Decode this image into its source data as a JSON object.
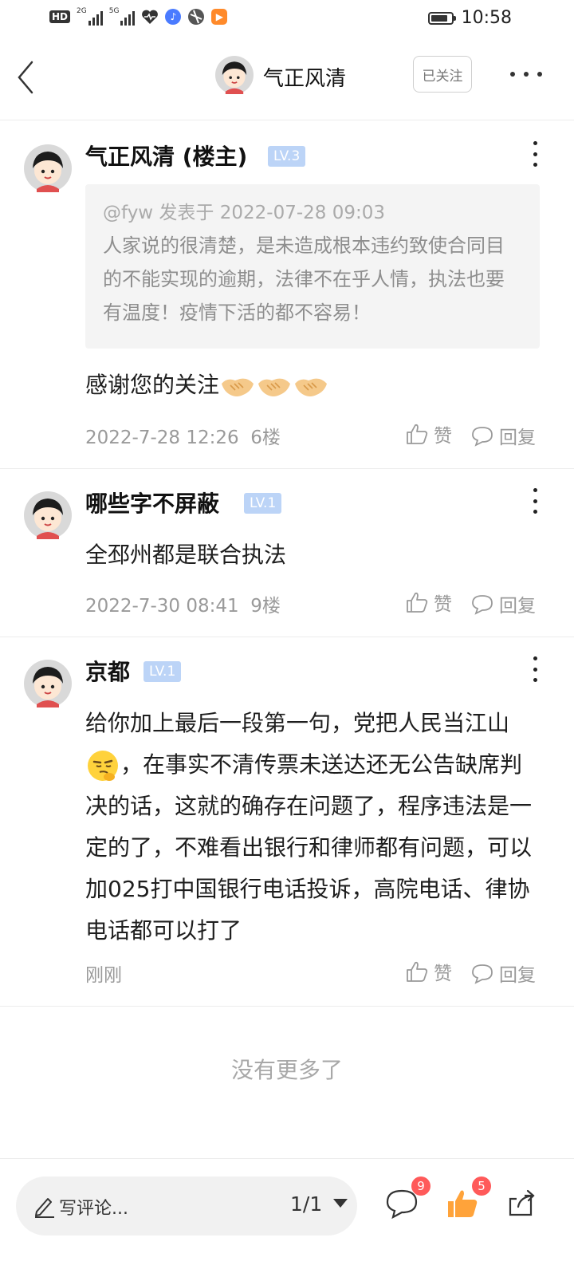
{
  "status_bar": {
    "hd_label": "HD",
    "net1": "2G",
    "net2": "5G",
    "time": "10:58",
    "battery_level": 0.85
  },
  "header": {
    "title": "气正风清",
    "follow_label": "已关注"
  },
  "comments": [
    {
      "name": "气正风清 (楼主)",
      "level": "LV.3",
      "quote": {
        "head": "@fyw 发表于 2022-07-28 09:03",
        "body": "人家说的很清楚，是未造成根本违约致使合同目的不能实现的逾期，法律不在乎人情，执法也要有温度！疫情下活的都不容易！"
      },
      "text": "感谢您的关注",
      "emoji": [
        "handshake",
        "handshake",
        "handshake"
      ],
      "date": "2022-7-28 12:26",
      "floor": "6楼",
      "like_label": "赞",
      "reply_label": "回复"
    },
    {
      "name": "哪些字不屏蔽",
      "level": "LV.1",
      "text": "全邳州都是联合执法",
      "date": "2022-7-30 08:41",
      "floor": "9楼",
      "like_label": "赞",
      "reply_label": "回复"
    },
    {
      "name": "京都",
      "level": "LV.1",
      "text_a": "给你加上最后一段第一句，党把人民当江山",
      "emoji": "thinking-face",
      "text_b": "，在事实不清传票未送达还无公告缺席判决的话，这就的确存在问题了，程序违法是一定的了，不难看出银行和律师都有问题，可以加025打中国银行电话投诉，高院电话、律协电话都可以打了",
      "date": "刚刚",
      "like_label": "赞",
      "reply_label": "回复"
    }
  ],
  "footer_text": "没有更多了",
  "bottom_bar": {
    "input_placeholder": "写评论...",
    "page_indicator": "1/1",
    "comment_count": "9",
    "like_count": "5"
  },
  "colors": {
    "level_badge": "#bcd4f7",
    "badge_red": "#ff5a5a",
    "like_orange": "#ffa33a"
  }
}
